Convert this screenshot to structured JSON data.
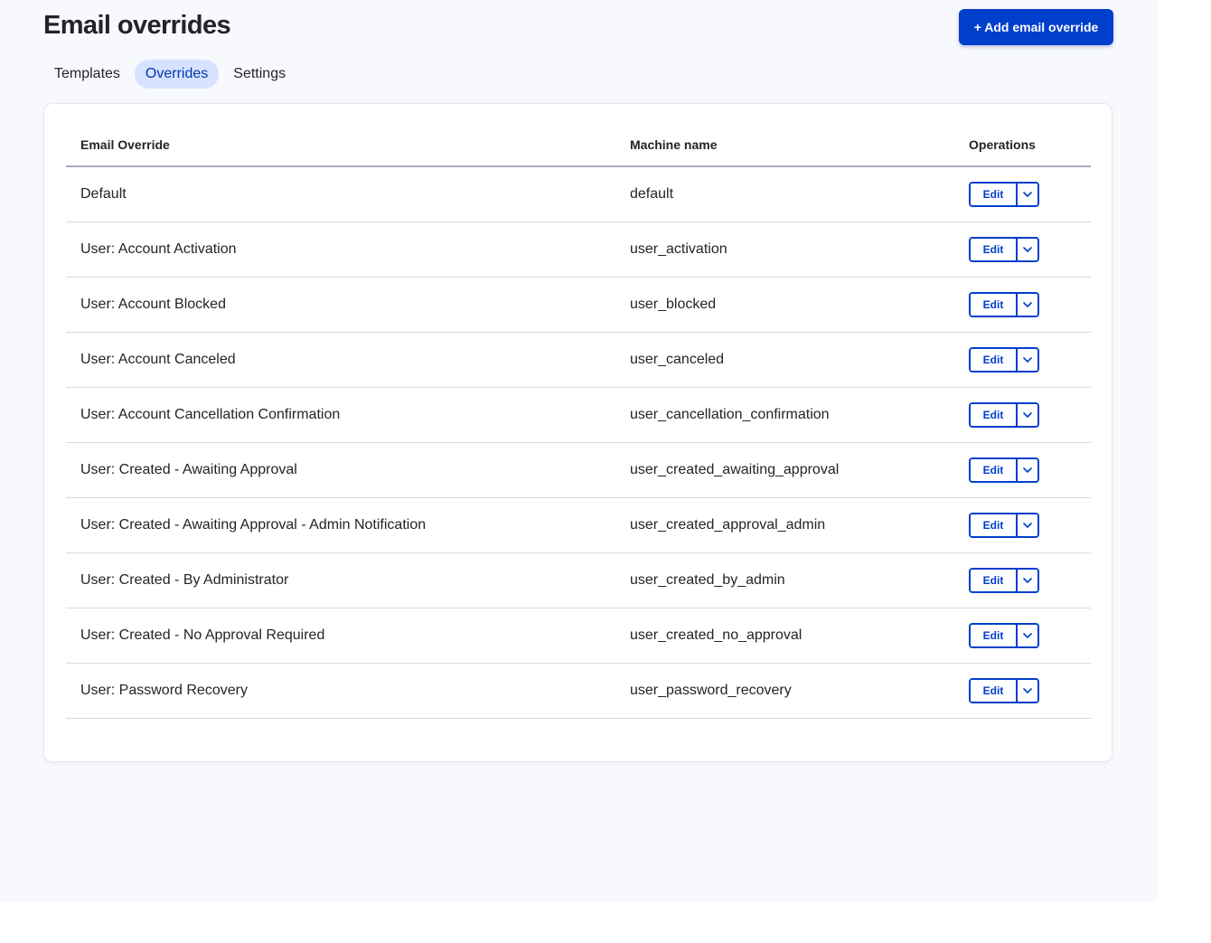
{
  "header": {
    "title": "Email overrides",
    "add_button_label": "+ Add email override"
  },
  "tabs": [
    {
      "label": "Templates",
      "active": false
    },
    {
      "label": "Overrides",
      "active": true
    },
    {
      "label": "Settings",
      "active": false
    }
  ],
  "table": {
    "columns": [
      "Email Override",
      "Machine name",
      "Operations"
    ],
    "edit_label": "Edit",
    "rows": [
      {
        "name": "Default",
        "machine": "default"
      },
      {
        "name": "User: Account Activation",
        "machine": "user_activation"
      },
      {
        "name": "User: Account Blocked",
        "machine": "user_blocked"
      },
      {
        "name": "User: Account Canceled",
        "machine": "user_canceled"
      },
      {
        "name": "User: Account Cancellation Confirmation",
        "machine": "user_cancellation_confirmation"
      },
      {
        "name": "User: Created - Awaiting Approval",
        "machine": "user_created_awaiting_approval"
      },
      {
        "name": "User: Created - Awaiting Approval - Admin Notification",
        "machine": "user_created_approval_admin"
      },
      {
        "name": "User: Created - By Administrator",
        "machine": "user_created_by_admin"
      },
      {
        "name": "User: Created - No Approval Required",
        "machine": "user_created_no_approval"
      },
      {
        "name": "User: Password Recovery",
        "machine": "user_password_recovery"
      }
    ]
  },
  "icons": {
    "dropdown": "chevron-down-icon"
  },
  "colors": {
    "accent": "#003ecc",
    "tab_active_bg": "#d6e2ff",
    "page_bg": "#f8f9fd"
  }
}
